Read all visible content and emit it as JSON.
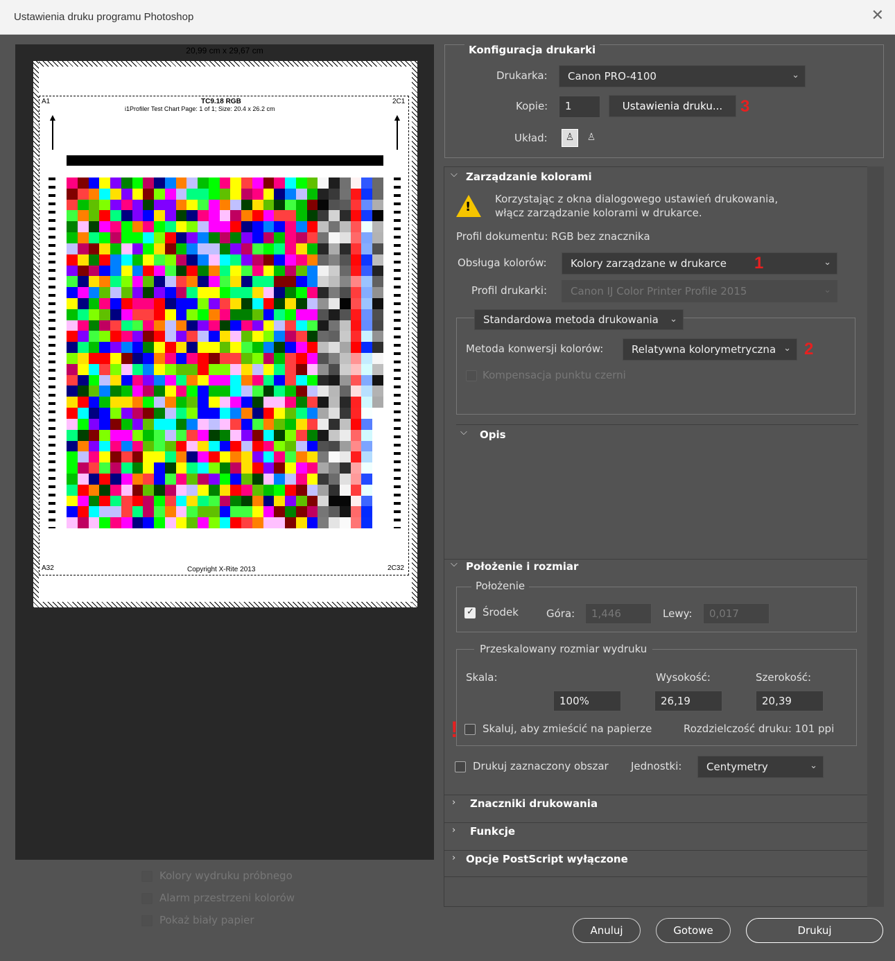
{
  "window": {
    "title": "Ustawienia druku programu Photoshop",
    "close": "✕"
  },
  "preview": {
    "dimensions": "20,99 cm x 29,67 cm",
    "chart_title": "TC9.18 RGB",
    "chart_subtitle": "i1Profiler Test Chart Page: 1 of 1; Size: 20.4 x 26.2 cm",
    "corner_tl": "A1",
    "corner_tr": "2C1",
    "corner_bl": "A32",
    "corner_br": "2C32",
    "copyright": "Copyright X-Rite 2013",
    "options": [
      "Kolory wydruku próbnego",
      "Alarm przestrzeni kolorów",
      "Pokaż biały papier"
    ]
  },
  "printer_setup": {
    "header": "Konfiguracja drukarki",
    "printer_label": "Drukarka:",
    "printer_value": "Canon PRO-4100",
    "copies_label": "Kopie:",
    "copies_value": "1",
    "print_settings_button": "Ustawienia druku...",
    "layout_label": "Układ:",
    "annotation_3": "3"
  },
  "color_management": {
    "header": "Zarządzanie kolorami",
    "warning_line1": "Korzystając z okna dialogowego ustawień drukowania,",
    "warning_line2": "włącz zarządzanie kolorami w drukarce.",
    "doc_profile": "Profil dokumentu: RGB bez znacznika",
    "handling_label": "Obsługa kolorów:",
    "handling_value": "Kolory zarządzane w drukarce",
    "annotation_1": "1",
    "printer_profile_label": "Profil drukarki:",
    "printer_profile_value": "Canon IJ Color Printer Profile 2015",
    "method_dropdown": "Standardowa metoda drukowania",
    "rendering_label": "Metoda konwersji kolorów:",
    "rendering_value": "Relatywna kolorymetryczna",
    "annotation_2": "2",
    "bpc_label": "Kompensacja punktu czerni"
  },
  "description": {
    "header": "Opis"
  },
  "position_size": {
    "header": "Położenie i rozmiar",
    "position_group": "Położenie",
    "center_label": "Środek",
    "top_label": "Góra:",
    "top_value": "1,446",
    "left_label": "Lewy:",
    "left_value": "0,017",
    "scaled_group": "Przeskalowany rozmiar wydruku",
    "scale_label": "Skala:",
    "scale_value": "100%",
    "height_label": "Wysokość:",
    "height_value": "26,19",
    "width_label": "Szerokość:",
    "width_value": "20,39",
    "annotation_excl": "!",
    "fit_label": "Skaluj, aby zmieścić na papierze",
    "resolution": "Rozdzielczość druku: 101 ppi",
    "print_selected_label": "Drukuj zaznaczony obszar",
    "units_label": "Jednostki:",
    "units_value": "Centymetry"
  },
  "sections": {
    "marks": "Znaczniki drukowania",
    "functions": "Funkcje",
    "postscript": "Opcje PostScript wyłączone"
  },
  "buttons": {
    "cancel": "Anuluj",
    "done": "Gotowe",
    "print": "Drukuj"
  },
  "colors": {
    "background": "#535353",
    "preview_bg": "#282828",
    "annotation": "#e62020",
    "warning": "#f5c400"
  }
}
